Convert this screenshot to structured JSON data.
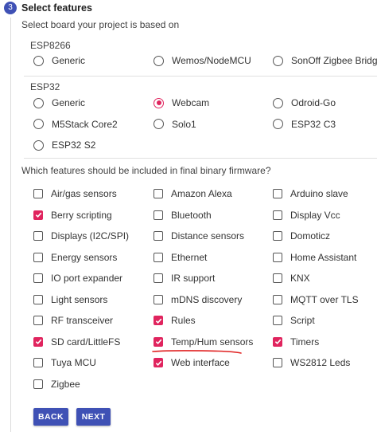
{
  "step": {
    "number": "3",
    "title": "Select features"
  },
  "board_question": "Select board your project is based on",
  "boards": {
    "esp8266": {
      "label": "ESP8266",
      "options": [
        {
          "label": "Generic",
          "selected": false
        },
        {
          "label": "Wemos/NodeMCU",
          "selected": false
        },
        {
          "label": "SonOff Zigbee Bridge",
          "selected": false
        }
      ]
    },
    "esp32": {
      "label": "ESP32",
      "options": [
        {
          "label": "Generic",
          "selected": false
        },
        {
          "label": "Webcam",
          "selected": true
        },
        {
          "label": "Odroid-Go",
          "selected": false
        },
        {
          "label": "M5Stack Core2",
          "selected": false
        },
        {
          "label": "Solo1",
          "selected": false
        },
        {
          "label": "ESP32 C3",
          "selected": false
        },
        {
          "label": "ESP32 S2",
          "selected": false
        }
      ]
    }
  },
  "features_question": "Which features should be included in final binary firmware?",
  "features": [
    {
      "label": "Air/gas sensors",
      "checked": false
    },
    {
      "label": "Amazon Alexa",
      "checked": false
    },
    {
      "label": "Arduino slave",
      "checked": false
    },
    {
      "label": "Berry scripting",
      "checked": true
    },
    {
      "label": "Bluetooth",
      "checked": false
    },
    {
      "label": "Display Vcc",
      "checked": false
    },
    {
      "label": "Displays (I2C/SPI)",
      "checked": false
    },
    {
      "label": "Distance sensors",
      "checked": false
    },
    {
      "label": "Domoticz",
      "checked": false
    },
    {
      "label": "Energy sensors",
      "checked": false
    },
    {
      "label": "Ethernet",
      "checked": false
    },
    {
      "label": "Home Assistant",
      "checked": false
    },
    {
      "label": "IO port expander",
      "checked": false
    },
    {
      "label": "IR support",
      "checked": false
    },
    {
      "label": "KNX",
      "checked": false
    },
    {
      "label": "Light sensors",
      "checked": false
    },
    {
      "label": "mDNS discovery",
      "checked": false
    },
    {
      "label": "MQTT over TLS",
      "checked": false
    },
    {
      "label": "RF transceiver",
      "checked": false
    },
    {
      "label": "Rules",
      "checked": true
    },
    {
      "label": "Script",
      "checked": false
    },
    {
      "label": "SD card/LittleFS",
      "checked": true
    },
    {
      "label": "Temp/Hum sensors",
      "checked": true
    },
    {
      "label": "Timers",
      "checked": true
    },
    {
      "label": "Tuya MCU",
      "checked": false
    },
    {
      "label": "Web interface",
      "checked": true
    },
    {
      "label": "WS2812 Leds",
      "checked": false
    },
    {
      "label": "Zigbee",
      "checked": false
    }
  ],
  "buttons": {
    "back": "BACK",
    "next": "NEXT"
  },
  "colors": {
    "accent": "#e0245e",
    "primary": "#3f51b5",
    "annotation": "#e02020"
  }
}
